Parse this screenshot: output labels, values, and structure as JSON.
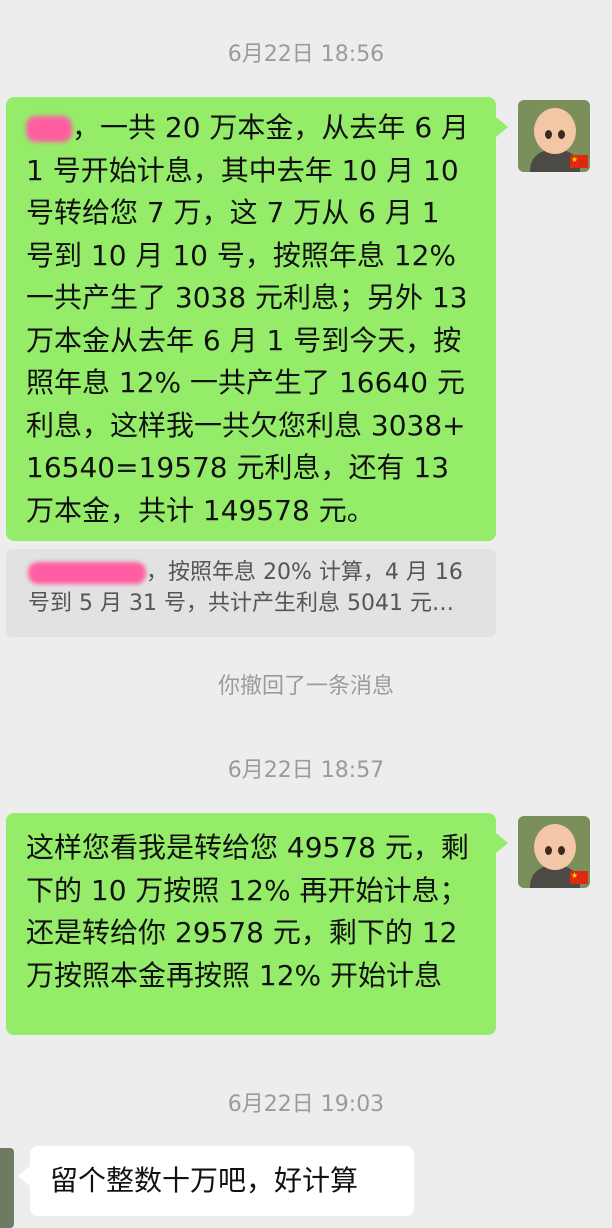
{
  "chat": {
    "time1": "6月22日 18:56",
    "msg1": "，一共 20 万本金，从去年 6 月 1 号开始计息，其中去年 10 月 10 号转给您 7 万，这 7 万从 6 月 1 号到 10 月 10 号，按照年息 12% 一共产生了 3038 元利息；另外 13 万本金从去年 6 月 1 号到今天，按照年息 12% 一共产生了 16640 元利息，这样我一共欠您利息 3038+16540=19578 元利息，还有 13 万本金，共计 149578 元。",
    "quote_line1": "按照年息 20% 计算，4 月 16",
    "quote_line2": "号到 5 月 31 号，共计产生利息 5041 元…",
    "recall_notice": "你撤回了一条消息",
    "time2": "6月22日 18:57",
    "msg2": "这样您看我是转给您 49578 元，剩下的 10 万按照 12% 再开始计息；还是转给你 29578 元，剩下的 12 万按照本金再按照 12% 开始计息",
    "time3": "6月22日 19:03",
    "msg3": "留个整数十万吧，好计算"
  },
  "colors": {
    "outgoing_bubble": "#95ec69",
    "incoming_bubble": "#ffffff",
    "background": "#ededed",
    "redaction": "#ff5fa2"
  },
  "icons": {
    "avatar": "cartoon-monk-avatar",
    "flag": "china-flag-badge"
  }
}
